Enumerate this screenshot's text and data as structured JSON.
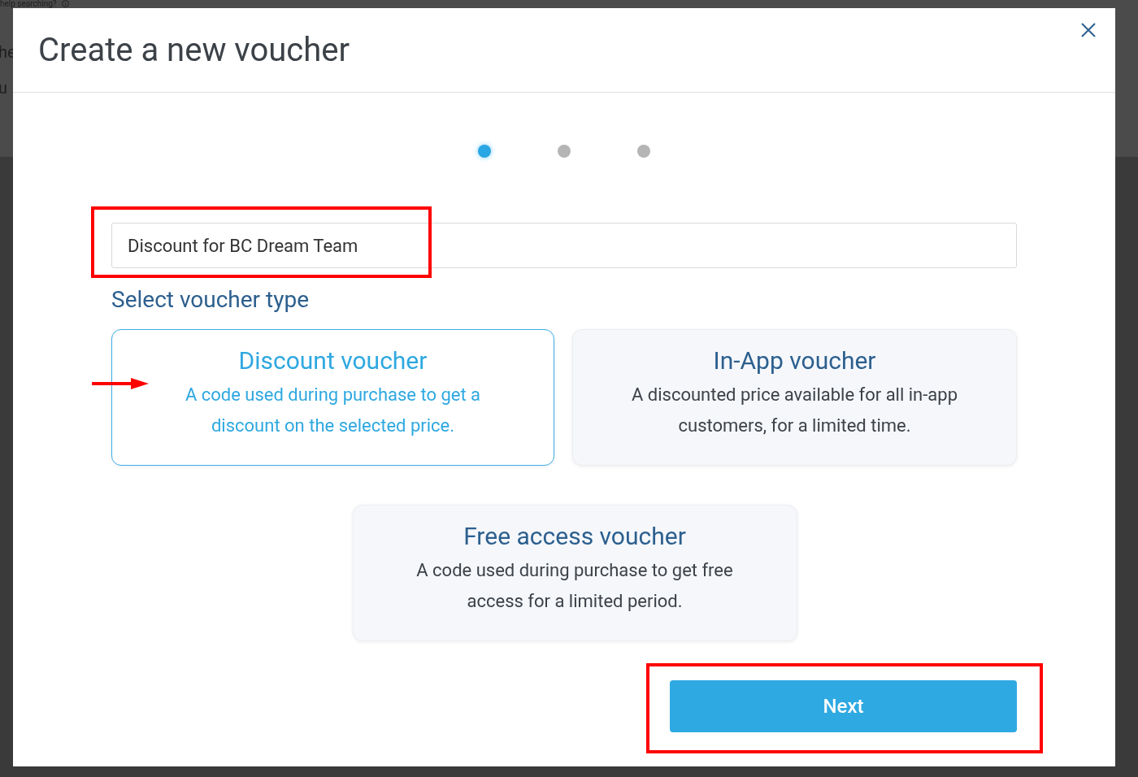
{
  "background": {
    "help_text": "help searching?",
    "fragments": [
      "he",
      "u"
    ]
  },
  "dialog": {
    "title": "Create a new voucher",
    "steps": [
      {
        "selected": true
      },
      {
        "selected": false
      },
      {
        "selected": false
      }
    ],
    "name_field": {
      "value": "Discount for BC Dream Team"
    },
    "section_label": "Select voucher type",
    "voucher_types": [
      {
        "title": "Discount voucher",
        "description": "A code used during purchase to get a discount on the selected price.",
        "selected": true
      },
      {
        "title": "In-App voucher",
        "description": "A discounted price available for all in-app customers, for a limited time.",
        "selected": false
      },
      {
        "title": "Free access voucher",
        "description": "A code used during purchase to get free access for a limited period.",
        "selected": false
      }
    ],
    "next_button": "Next"
  },
  "annotations": [
    {
      "kind": "box"
    },
    {
      "kind": "arrow"
    },
    {
      "kind": "box"
    }
  ]
}
